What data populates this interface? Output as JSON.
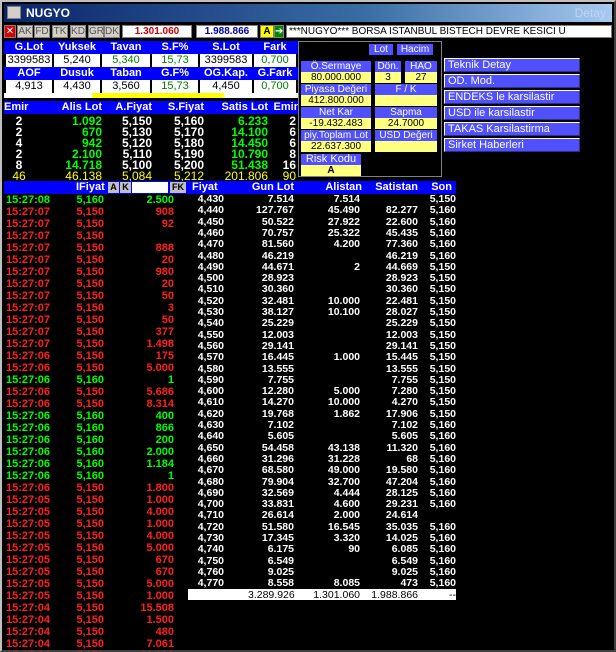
{
  "window": {
    "title": "NUGYO",
    "right_text": "Detay"
  },
  "toolbar": {
    "buttons": [
      "AK",
      "FD",
      "TK",
      "KD",
      "GR",
      "DK"
    ],
    "price": "1.301.060",
    "volume": "1.988.866",
    "flag": "A",
    "ticker": "***NUGYO*** BORSA ISTANBUL BISTECH DEVRE KESICI U"
  },
  "summary": {
    "headers1": [
      "G.Lot",
      "Yuksek",
      "Tavan",
      "S.F%",
      "S.Lot",
      "Fark"
    ],
    "values1": [
      "3399583",
      "5,240",
      "5,340",
      "15,73",
      "3399583",
      "0,700"
    ],
    "headers2": [
      "AOF",
      "Dusuk",
      "Taban",
      "G.F%",
      "OG.Kap.",
      "G.Fark"
    ],
    "values2": [
      "4,913",
      "4,430",
      "3,560",
      "15,73",
      "4,450",
      "0,700"
    ]
  },
  "info_panel": {
    "lot_label": "Lot",
    "hacim_label": "Hacim",
    "osermaye_label": "Ö.Sermaye",
    "osermaye_value": "80.000.000",
    "don_label": "Dön.",
    "don_value": "3",
    "hao_label": "HAO",
    "hao_value": "27",
    "piyasa_label": "Piyasa Değeri",
    "piyasa_value": "412.800.000",
    "fk_label": "F / K",
    "fk_value": "",
    "netkar_label": "Net Kar",
    "netkar_value": "-19.432.483",
    "sapma_label": "Sapma",
    "sapma_value": "24.7000",
    "piy_label": "piy.Toplam Lot",
    "piy_value": "22.637.300",
    "usd_label": "USD Değeri",
    "usd_value": "",
    "risk_label": "Risk Kodu",
    "risk_value": "A"
  },
  "side_buttons": [
    "Teknik Detay",
    "OD. Mod.",
    "ENDEKS le karsilastir",
    "USD ile karsilastir",
    "TAKAS Karsilastirma",
    "Sirket Haberleri"
  ],
  "depth": {
    "headers": [
      "Emir",
      "Alis Lot",
      "A.Fiyat",
      "S.Fiyat",
      "Satis Lot",
      "Emir"
    ],
    "rows": [
      [
        "2",
        "1.092",
        "5,150",
        "5,160",
        "6.233",
        "2"
      ],
      [
        "2",
        "670",
        "5,130",
        "5,170",
        "14.100",
        "6"
      ],
      [
        "4",
        "942",
        "5,120",
        "5,180",
        "14.450",
        "6"
      ],
      [
        "2",
        "2.100",
        "5,110",
        "5,190",
        "10.790",
        "8"
      ],
      [
        "8",
        "14.718",
        "5,100",
        "5,200",
        "51.438",
        "16"
      ],
      [
        "46",
        "46.138",
        "5,084",
        "5,212",
        "201.806",
        "90"
      ]
    ]
  },
  "trades": {
    "header_price": "IFiyat",
    "header_a": "A",
    "header_k": "K",
    "header_fk": "FK",
    "rows": [
      [
        "15:27:08",
        "5,160",
        "2.500",
        "g"
      ],
      [
        "15:27:07",
        "5,150",
        "908",
        "r"
      ],
      [
        "15:27:07",
        "5,150",
        "92",
        "r"
      ],
      [
        "15:27:07",
        "5,150",
        "",
        ""
      ],
      [
        "15:27:07",
        "5,150",
        "888",
        "r"
      ],
      [
        "15:27:07",
        "5,150",
        "20",
        "r"
      ],
      [
        "15:27:07",
        "5,150",
        "980",
        "r"
      ],
      [
        "15:27:07",
        "5,150",
        "20",
        "r"
      ],
      [
        "15:27:07",
        "5,150",
        "50",
        "r"
      ],
      [
        "15:27:07",
        "5,150",
        "3",
        "r"
      ],
      [
        "15:27:07",
        "5,150",
        "50",
        "r"
      ],
      [
        "15:27:07",
        "5,150",
        "377",
        "r"
      ],
      [
        "15:27:07",
        "5,150",
        "1.498",
        "r"
      ],
      [
        "15:27:06",
        "5,150",
        "175",
        "r"
      ],
      [
        "15:27:06",
        "5,150",
        "5.000",
        "r"
      ],
      [
        "15:27:06",
        "5,160",
        "1",
        "g"
      ],
      [
        "15:27:06",
        "5,150",
        "5.686",
        "r"
      ],
      [
        "15:27:06",
        "5,150",
        "8.314",
        "r"
      ],
      [
        "15:27:06",
        "5,160",
        "400",
        "g"
      ],
      [
        "15:27:06",
        "5,160",
        "866",
        "g"
      ],
      [
        "15:27:06",
        "5,160",
        "200",
        "g"
      ],
      [
        "15:27:06",
        "5,160",
        "2.000",
        "g"
      ],
      [
        "15:27:06",
        "5,160",
        "1.184",
        "g"
      ],
      [
        "15:27:06",
        "5,160",
        "1",
        "g"
      ],
      [
        "15:27:06",
        "5,150",
        "1.800",
        "r"
      ],
      [
        "15:27:05",
        "5,150",
        "1.000",
        "r"
      ],
      [
        "15:27:05",
        "5,150",
        "4.000",
        "r"
      ],
      [
        "15:27:05",
        "5,150",
        "1.000",
        "r"
      ],
      [
        "15:27:05",
        "5,150",
        "4.000",
        "r"
      ],
      [
        "15:27:05",
        "5,150",
        "5.000",
        "r"
      ],
      [
        "15:27:05",
        "5,150",
        "670",
        "r"
      ],
      [
        "15:27:05",
        "5,150",
        "670",
        "r"
      ],
      [
        "15:27:05",
        "5,150",
        "5.000",
        "r"
      ],
      [
        "15:27:05",
        "5,150",
        "1.000",
        "r"
      ],
      [
        "15:27:04",
        "5,150",
        "15.508",
        "r"
      ],
      [
        "15:27:04",
        "5,150",
        "1.500",
        "r"
      ],
      [
        "15:27:04",
        "5,150",
        "480",
        "r"
      ],
      [
        "15:27:04",
        "5,150",
        "7.061",
        "r"
      ],
      [
        "15:27:04",
        "5,150",
        "10.000",
        "r"
      ]
    ]
  },
  "levels": {
    "headers": [
      "Fiyat",
      "Gun Lot",
      "Alistan",
      "Satistan",
      "Son"
    ],
    "rows": [
      [
        "4,430",
        "7.514",
        "7.514",
        "",
        "5,150"
      ],
      [
        "4,440",
        "127.767",
        "45.490",
        "82.277",
        "5,160"
      ],
      [
        "4,450",
        "50.522",
        "27.922",
        "22.600",
        "5,160"
      ],
      [
        "4,460",
        "70.757",
        "25.322",
        "45.435",
        "5,160"
      ],
      [
        "4,470",
        "81.560",
        "4.200",
        "77.360",
        "5,160"
      ],
      [
        "4,480",
        "46.219",
        "",
        "46.219",
        "5,160"
      ],
      [
        "4,490",
        "44.671",
        "2",
        "44.669",
        "5,150"
      ],
      [
        "4,500",
        "28.923",
        "",
        "28.923",
        "5,150"
      ],
      [
        "4,510",
        "30.360",
        "",
        "30.360",
        "5,150"
      ],
      [
        "4,520",
        "32.481",
        "10.000",
        "22.481",
        "5,150"
      ],
      [
        "4,530",
        "38.127",
        "10.100",
        "28.027",
        "5,150"
      ],
      [
        "4,540",
        "25.229",
        "",
        "25.229",
        "5,150"
      ],
      [
        "4,550",
        "12.003",
        "",
        "12.003",
        "5,150"
      ],
      [
        "4,560",
        "29.141",
        "",
        "29.141",
        "5,150"
      ],
      [
        "4,570",
        "16.445",
        "1.000",
        "15.445",
        "5,150"
      ],
      [
        "4,580",
        "13.555",
        "",
        "13.555",
        "5,150"
      ],
      [
        "4,590",
        "7.755",
        "",
        "7.755",
        "5,150"
      ],
      [
        "4,600",
        "12.280",
        "5.000",
        "7.280",
        "5,150"
      ],
      [
        "4,610",
        "14.270",
        "10.000",
        "4.270",
        "5,150"
      ],
      [
        "4,620",
        "19.768",
        "1.862",
        "17.906",
        "5,150"
      ],
      [
        "4,630",
        "7.102",
        "",
        "7.102",
        "5,160"
      ],
      [
        "4,640",
        "5.605",
        "",
        "5.605",
        "5,160"
      ],
      [
        "4,650",
        "54.458",
        "43.138",
        "11.320",
        "5,160"
      ],
      [
        "4,660",
        "31.296",
        "31.228",
        "68",
        "5,160"
      ],
      [
        "4,670",
        "68.580",
        "49.000",
        "19.580",
        "5,160"
      ],
      [
        "4,680",
        "79.904",
        "32.700",
        "47.204",
        "5,160"
      ],
      [
        "4,690",
        "32.569",
        "4.444",
        "28.125",
        "5,160"
      ],
      [
        "4,700",
        "33.831",
        "4.600",
        "29.231",
        "5,160"
      ],
      [
        "4,710",
        "26.614",
        "2.000",
        "24.614",
        ""
      ],
      [
        "4,720",
        "51.580",
        "16.545",
        "35.035",
        "5,160"
      ],
      [
        "4,730",
        "17.345",
        "3.320",
        "14.025",
        "5,160"
      ],
      [
        "4,740",
        "6.175",
        "90",
        "6.085",
        "5,160"
      ],
      [
        "4,750",
        "6.549",
        "",
        "6.549",
        "5,160"
      ],
      [
        "4,760",
        "9.025",
        "",
        "9.025",
        "5,160"
      ],
      [
        "4,770",
        "8.558",
        "8.085",
        "473",
        "5,160"
      ]
    ],
    "totals": [
      "",
      "3.289.926",
      "1.301.060",
      "1.988.866",
      "--"
    ]
  }
}
